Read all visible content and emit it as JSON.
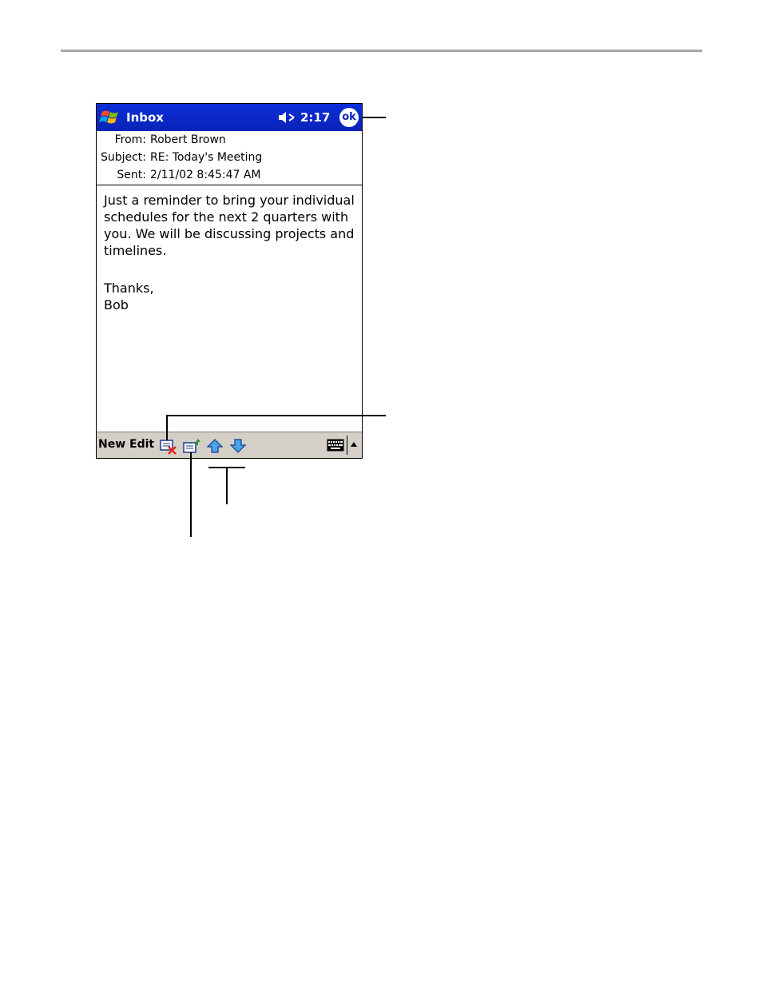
{
  "window": {
    "title": "Inbox",
    "clock": "2:17",
    "ok_label": "ok"
  },
  "message": {
    "from_label": "From:",
    "from_value": "Robert Brown",
    "subject_label": "Subject:",
    "subject_value": "RE: Today's Meeting",
    "sent_label": "Sent:",
    "sent_value": "2/11/02 8:45:47 AM",
    "body": [
      "Just a reminder to bring your individual",
      "schedules for the next 2 quarters with",
      "you. We will be discussing projects and",
      "timelines."
    ],
    "signoff": [
      "Thanks,",
      "Bob"
    ]
  },
  "toolbar": {
    "new_label": "New",
    "edit_label": "Edit",
    "icons": [
      "delete-message-icon",
      "move-message-icon",
      "previous-message-icon",
      "next-message-icon",
      "keyboard-icon",
      "sip-arrow-icon"
    ]
  },
  "colors": {
    "titlebar": "#0a24b8",
    "toolbar": "#d4d0c8"
  }
}
